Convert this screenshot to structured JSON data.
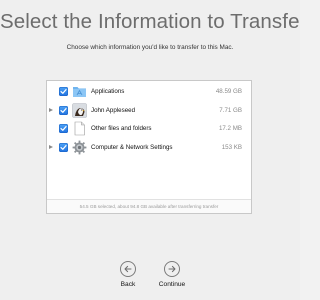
{
  "header": {
    "title": "Select the Information to Transfer",
    "subtitle": "Choose which information you'd like to transfer to this Mac."
  },
  "items": [
    {
      "label": "Applications",
      "size": "48.59 GB",
      "checked": true,
      "expandable": false,
      "icon": "applications-folder-icon"
    },
    {
      "label": "John Appleseed",
      "size": "7.71 GB",
      "checked": true,
      "expandable": true,
      "icon": "user-avatar-icon"
    },
    {
      "label": "Other files and folders",
      "size": "17.2 MB",
      "checked": true,
      "expandable": false,
      "icon": "document-icon"
    },
    {
      "label": "Computer & Network Settings",
      "size": "153 KB",
      "checked": true,
      "expandable": true,
      "icon": "gear-icon"
    }
  ],
  "footer": {
    "summary": "54.5 GB selected, about 94.8 GB available after transferring transfer"
  },
  "nav": {
    "back_label": "Back",
    "continue_label": "Continue"
  },
  "colors": {
    "checkbox": "#2f86ea",
    "background": "#efefef"
  }
}
